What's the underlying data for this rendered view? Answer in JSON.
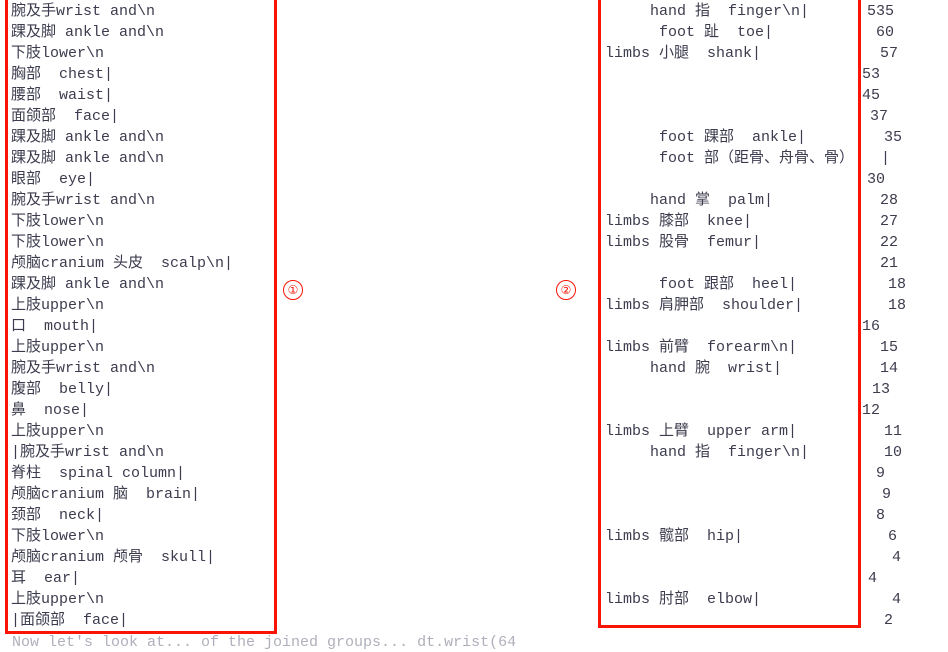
{
  "annotations": {
    "marker_one": "①",
    "marker_two": "②",
    "box_color": "#fa1405"
  },
  "left_column": {
    "name": "body-part-label-list-left",
    "rows": [
      "腕及手wrist and\\n",
      "踝及脚 ankle and\\n",
      "下肢lower\\n",
      "胸部  chest|",
      "腰部  waist|",
      "面颌部  face|",
      "踝及脚 ankle and\\n",
      "踝及脚 ankle and\\n",
      "眼部  eye|",
      "腕及手wrist and\\n",
      "下肢lower\\n",
      "下肢lower\\n",
      "颅脑cranium 头皮  scalp\\n|",
      "踝及脚 ankle and\\n",
      "上肢upper\\n",
      "口  mouth|",
      "上肢upper\\n",
      "腕及手wrist and\\n",
      "腹部  belly|",
      "鼻  nose|",
      "上肢upper\\n",
      "|腕及手wrist and\\n",
      "脊柱  spinal column|",
      "颅脑cranium 脑  brain|",
      "颈部  neck|",
      "下肢lower\\n",
      "颅脑cranium 颅骨  skull|",
      "耳  ear|",
      "上肢upper\\n",
      "|面颌部  face|"
    ]
  },
  "middle_column": {
    "name": "body-part-label-list-right",
    "rows": [
      "     hand 指  finger\\n|",
      "      foot 趾  toe|",
      "limbs 小腿  shank|",
      "",
      "",
      "",
      "      foot 踝部  ankle|",
      "      foot 部（距骨、舟骨、骨）   |",
      "",
      "     hand 掌  palm|",
      "limbs 膝部  knee|",
      "limbs 股骨  femur|",
      "",
      "      foot 跟部  heel|",
      "limbs 肩胛部  shoulder|",
      "",
      "limbs 前臂  forearm\\n|",
      "     hand 腕  wrist|",
      "",
      "",
      "limbs 上臂  upper arm|",
      "     hand 指  finger\\n|",
      "",
      "",
      "",
      "limbs 髋部  hip|",
      "",
      "",
      "limbs 肘部  elbow|"
    ]
  },
  "count_column": {
    "name": "frequency-count-list",
    "rows": [
      {
        "value": "535",
        "indent": 5
      },
      {
        "value": "60",
        "indent": 14
      },
      {
        "value": "57",
        "indent": 18
      },
      {
        "value": "53",
        "indent": 0
      },
      {
        "value": "45",
        "indent": 0
      },
      {
        "value": "37",
        "indent": 8
      },
      {
        "value": "35",
        "indent": 22
      },
      {
        "value": "",
        "indent": 0
      },
      {
        "value": "30",
        "indent": 5
      },
      {
        "value": "28",
        "indent": 18
      },
      {
        "value": "27",
        "indent": 18
      },
      {
        "value": "22",
        "indent": 18
      },
      {
        "value": "21",
        "indent": 18
      },
      {
        "value": "18",
        "indent": 26
      },
      {
        "value": "18",
        "indent": 26
      },
      {
        "value": "16",
        "indent": -4
      },
      {
        "value": "15",
        "indent": 18
      },
      {
        "value": "14",
        "indent": 18
      },
      {
        "value": "13",
        "indent": 10
      },
      {
        "value": "12",
        "indent": -4
      },
      {
        "value": "11",
        "indent": 22
      },
      {
        "value": "10",
        "indent": 22
      },
      {
        "value": "9",
        "indent": 14
      },
      {
        "value": "9",
        "indent": 20
      },
      {
        "value": "8",
        "indent": 14
      },
      {
        "value": "6",
        "indent": 26
      },
      {
        "value": "4",
        "indent": 30
      },
      {
        "value": "4",
        "indent": 6
      },
      {
        "value": "4",
        "indent": 30
      },
      {
        "value": "2",
        "indent": 22
      }
    ]
  },
  "bottom_clipped_line": {
    "text": "Now let's look at... of the joined groups... dt.wrist(64"
  }
}
